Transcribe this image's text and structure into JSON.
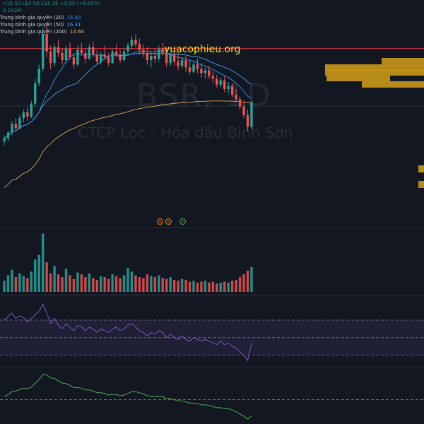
{
  "legend": {
    "ohlc_text": "H15.50 L14.50 C15.35 +0.95 (+6.60%)",
    "volume_text": "8.243M",
    "ma20_label": "Trung bình gia quyền (20)",
    "ma20_value": "15.00",
    "ma50_label": "Trung bình gia quyền (50)",
    "ma50_value": "16.31",
    "ma200_label": "Trung bình gia quyền (200)",
    "ma200_value": "14.60"
  },
  "watermark": {
    "site": "vuacophieu.org",
    "ticker": "BSR, 1D",
    "name": "CTCP Lọc - Hóa dầu Bình Sơn"
  },
  "events": [
    {
      "label": "S",
      "kind": "split"
    },
    {
      "label": "S",
      "kind": "split"
    },
    {
      "label": "F",
      "kind": "financial"
    }
  ],
  "colors": {
    "background": "#131722",
    "up": "#26a69a",
    "down": "#ef5350",
    "ma20": "#2196f3",
    "ma50": "#42a5f5",
    "ma200": "#ffb74d",
    "rsi": "#7e57c2",
    "macd": "#4caf50",
    "volume_profile": "#d4a017",
    "resistance": "#f23645",
    "site_text": "#f2e900"
  },
  "chart_data": {
    "type": "candlestick",
    "symbol": "BSR",
    "interval": "1D",
    "ylim": [
      12.0,
      22.0
    ],
    "resistance_level": 20.6,
    "ohlc": [
      [
        14.2,
        14.6,
        13.9,
        14.4
      ],
      [
        14.4,
        14.9,
        14.2,
        14.8
      ],
      [
        14.8,
        15.6,
        14.6,
        15.4
      ],
      [
        15.4,
        15.8,
        14.9,
        15.1
      ],
      [
        15.1,
        16.0,
        15.0,
        15.8
      ],
      [
        15.8,
        16.4,
        15.5,
        16.2
      ],
      [
        16.2,
        16.5,
        15.6,
        15.9
      ],
      [
        15.9,
        17.0,
        15.8,
        16.8
      ],
      [
        16.8,
        18.5,
        16.6,
        18.2
      ],
      [
        18.2,
        19.5,
        18.0,
        19.2
      ],
      [
        19.2,
        22.0,
        19.0,
        21.6
      ],
      [
        21.6,
        22.4,
        20.0,
        20.4
      ],
      [
        20.4,
        20.8,
        19.2,
        19.6
      ],
      [
        19.6,
        20.9,
        19.4,
        20.7
      ],
      [
        20.7,
        21.2,
        20.0,
        20.3
      ],
      [
        20.3,
        20.6,
        19.5,
        19.8
      ],
      [
        19.8,
        20.8,
        19.6,
        20.6
      ],
      [
        20.6,
        21.0,
        19.8,
        20.0
      ],
      [
        20.0,
        20.3,
        19.2,
        19.5
      ],
      [
        19.5,
        20.8,
        19.4,
        20.5
      ],
      [
        20.5,
        21.0,
        20.1,
        20.3
      ],
      [
        20.3,
        20.6,
        19.6,
        19.9
      ],
      [
        19.9,
        20.9,
        19.8,
        20.7
      ],
      [
        20.7,
        21.1,
        20.0,
        20.2
      ],
      [
        20.2,
        20.5,
        19.5,
        19.7
      ],
      [
        19.7,
        20.4,
        19.5,
        20.2
      ],
      [
        20.2,
        20.8,
        19.8,
        20.0
      ],
      [
        20.0,
        20.3,
        19.4,
        19.6
      ],
      [
        19.6,
        20.6,
        19.5,
        20.4
      ],
      [
        20.4,
        20.9,
        20.0,
        20.2
      ],
      [
        20.2,
        20.5,
        19.6,
        19.8
      ],
      [
        19.8,
        20.6,
        19.7,
        20.4
      ],
      [
        20.4,
        21.0,
        20.1,
        20.8
      ],
      [
        20.8,
        21.5,
        20.5,
        21.2
      ],
      [
        21.2,
        21.6,
        20.7,
        20.9
      ],
      [
        20.9,
        21.3,
        20.2,
        20.5
      ],
      [
        20.5,
        20.9,
        20.0,
        20.3
      ],
      [
        20.3,
        20.7,
        19.5,
        19.8
      ],
      [
        19.8,
        20.4,
        19.3,
        20.1
      ],
      [
        20.1,
        20.6,
        19.6,
        19.9
      ],
      [
        19.9,
        20.8,
        19.7,
        20.6
      ],
      [
        20.6,
        21.0,
        20.1,
        20.3
      ],
      [
        20.3,
        20.7,
        19.3,
        19.6
      ],
      [
        19.6,
        20.4,
        19.4,
        20.2
      ],
      [
        20.2,
        20.5,
        19.4,
        19.7
      ],
      [
        19.7,
        20.4,
        19.1,
        19.4
      ],
      [
        19.4,
        20.0,
        19.2,
        19.8
      ],
      [
        19.8,
        20.1,
        19.0,
        19.3
      ],
      [
        19.3,
        19.8,
        18.8,
        19.0
      ],
      [
        19.0,
        19.7,
        18.9,
        19.5
      ],
      [
        19.5,
        19.9,
        18.9,
        19.2
      ],
      [
        19.2,
        19.6,
        18.6,
        18.9
      ],
      [
        18.9,
        19.3,
        18.5,
        19.1
      ],
      [
        19.1,
        19.4,
        18.5,
        18.7
      ],
      [
        18.7,
        19.0,
        18.2,
        18.5
      ],
      [
        18.5,
        18.8,
        17.9,
        18.1
      ],
      [
        18.1,
        18.6,
        17.9,
        18.4
      ],
      [
        18.4,
        18.7,
        17.6,
        17.8
      ],
      [
        17.8,
        18.3,
        17.5,
        18.0
      ],
      [
        18.0,
        18.2,
        17.2,
        17.4
      ],
      [
        17.4,
        17.8,
        16.9,
        17.1
      ],
      [
        17.1,
        17.3,
        16.4,
        16.6
      ],
      [
        16.6,
        17.0,
        15.8,
        16.0
      ],
      [
        16.0,
        16.4,
        14.9,
        15.2
      ],
      [
        15.2,
        17.0,
        15.0,
        16.9
      ]
    ],
    "volume": [
      1.2,
      1.8,
      2.4,
      1.6,
      2.0,
      1.7,
      1.5,
      2.2,
      3.5,
      4.0,
      6.3,
      3.2,
      2.0,
      2.8,
      1.9,
      1.6,
      2.5,
      1.8,
      1.4,
      2.1,
      1.9,
      1.6,
      2.0,
      1.5,
      1.3,
      1.7,
      1.6,
      1.4,
      1.9,
      1.7,
      1.5,
      1.8,
      2.6,
      2.2,
      1.8,
      1.6,
      1.5,
      1.9,
      1.7,
      1.6,
      1.8,
      1.5,
      1.4,
      1.6,
      1.3,
      1.2,
      1.4,
      1.3,
      1.1,
      1.2,
      1.0,
      1.1,
      1.2,
      1.0,
      1.1,
      0.9,
      1.0,
      1.1,
      1.0,
      1.2,
      1.3,
      1.6,
      1.9,
      2.3,
      2.7
    ],
    "rsi": [
      70,
      74,
      78,
      72,
      75,
      73,
      68,
      72,
      76,
      80,
      88,
      78,
      66,
      72,
      64,
      60,
      66,
      62,
      58,
      64,
      62,
      58,
      62,
      60,
      56,
      60,
      58,
      56,
      60,
      62,
      58,
      60,
      64,
      66,
      62,
      58,
      56,
      52,
      56,
      54,
      58,
      56,
      50,
      54,
      50,
      48,
      52,
      48,
      46,
      50,
      48,
      46,
      48,
      46,
      44,
      42,
      46,
      42,
      44,
      40,
      38,
      34,
      30,
      24,
      44
    ],
    "macd": [
      0.1,
      0.18,
      0.28,
      0.3,
      0.36,
      0.4,
      0.38,
      0.44,
      0.56,
      0.7,
      0.88,
      0.86,
      0.76,
      0.74,
      0.66,
      0.58,
      0.56,
      0.5,
      0.42,
      0.42,
      0.4,
      0.34,
      0.34,
      0.3,
      0.24,
      0.24,
      0.22,
      0.16,
      0.18,
      0.18,
      0.14,
      0.16,
      0.22,
      0.28,
      0.28,
      0.24,
      0.2,
      0.14,
      0.12,
      0.1,
      0.12,
      0.1,
      0.04,
      0.04,
      0.0,
      -0.04,
      -0.04,
      -0.08,
      -0.12,
      -0.12,
      -0.14,
      -0.18,
      -0.18,
      -0.2,
      -0.24,
      -0.28,
      -0.28,
      -0.32,
      -0.32,
      -0.36,
      -0.42,
      -0.5,
      -0.58,
      -0.68,
      -0.56
    ]
  }
}
